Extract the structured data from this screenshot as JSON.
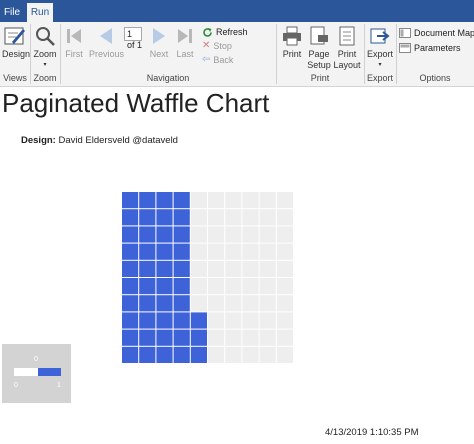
{
  "tabs": {
    "file": "File",
    "run": "Run"
  },
  "ribbon": {
    "views": {
      "design": "Design",
      "group": "Views"
    },
    "zoom": {
      "zoom": "Zoom",
      "group": "Zoom"
    },
    "navigation": {
      "first": "First",
      "previous": "Previous",
      "page_value": "1",
      "of_label": "of 1",
      "next": "Next",
      "last": "Last",
      "refresh": "Refresh",
      "stop": "Stop",
      "back": "Back",
      "group": "Navigation"
    },
    "print": {
      "print": "Print",
      "page_setup_1": "Page",
      "page_setup_2": "Setup",
      "print_layout_1": "Print",
      "print_layout_2": "Layout",
      "group": "Print"
    },
    "export": {
      "export": "Export",
      "group": "Export"
    },
    "options": {
      "document_map": "Document Map",
      "parameters": "Parameters",
      "group": "Options"
    }
  },
  "report": {
    "title": "Paginated Waffle Chart",
    "design_label": "Design:",
    "design_value": "David Eldersveld @dataveld",
    "timestamp": "4/13/2019 1:10:35 PM"
  },
  "waffle": {
    "rows": 10,
    "cols": 10,
    "filled_columns": [
      10,
      10,
      10,
      10,
      3,
      0,
      0,
      0,
      0,
      0
    ],
    "filled_color": "#3e63d9",
    "empty_color": "#eeeeee"
  },
  "legend": {
    "top": "0",
    "min": "0",
    "max": "1"
  }
}
